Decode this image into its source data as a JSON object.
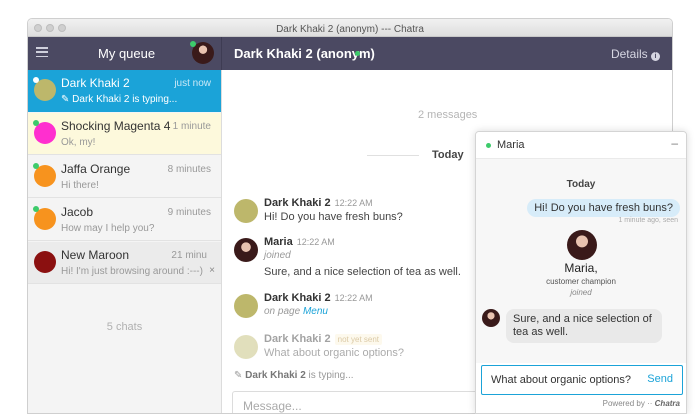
{
  "window": {
    "title": "Dark Khaki 2 (anonym) --- Chatra"
  },
  "header": {
    "queue_title": "My queue",
    "chat_title": "Dark Khaki 2 (anonym)",
    "details_label": "Details"
  },
  "sidebar": {
    "items": [
      {
        "name": "Dark Khaki 2",
        "time": "just now",
        "preview": "Dark Khaki 2 is typing...",
        "color": "#bdb76b"
      },
      {
        "name": "Shocking Magenta 4",
        "time": "1 minute",
        "preview": "Ok, my!",
        "color": "#ff2fcf"
      },
      {
        "name": "Jaffa Orange",
        "time": "8 minutes",
        "preview": "Hi there!",
        "color": "#f7931e"
      },
      {
        "name": "Jacob",
        "time": "9 minutes",
        "preview": "How may I help you?",
        "color": "#f7931e"
      },
      {
        "name": "New Maroon",
        "time": "21 minu",
        "preview": "Hi! I'm just browsing around :---)",
        "color": "#8b1010"
      }
    ],
    "chats_count": "5 chats"
  },
  "conversation": {
    "message_count": "2 messages",
    "today_label": "Today",
    "messages": [
      {
        "author": "Dark Khaki 2",
        "time": "12:22 AM",
        "text": "Hi! Do you have fresh buns?"
      },
      {
        "author": "Maria",
        "time": "12:22 AM",
        "system": "joined",
        "text": "Sure, and a nice selection of tea as well."
      },
      {
        "author": "Dark Khaki 2",
        "time": "12:22 AM",
        "system_prefix": "on page",
        "system_link": "Menu"
      },
      {
        "author": "Dark Khaki 2",
        "badge": "not yet sent",
        "text": "What about organic options?"
      }
    ],
    "typing_name": "Dark Khaki 2",
    "typing_suffix": "is typing...",
    "input_placeholder": "Message..."
  },
  "widget": {
    "agent_name": "Maria",
    "minimize": "–",
    "today_label": "Today",
    "visitor_message": "Hi! Do you have fresh buns?",
    "visitor_meta": "1 minute ago, seen",
    "agent_big_name": "Maria,",
    "agent_role": "customer champion",
    "agent_joined": "joined",
    "agent_message": "Sure, and a nice selection of tea as well.",
    "input_value": "What about organic options?",
    "send_label": "Send",
    "powered_prefix": "Powered by ··",
    "powered_brand": "Chatra"
  }
}
